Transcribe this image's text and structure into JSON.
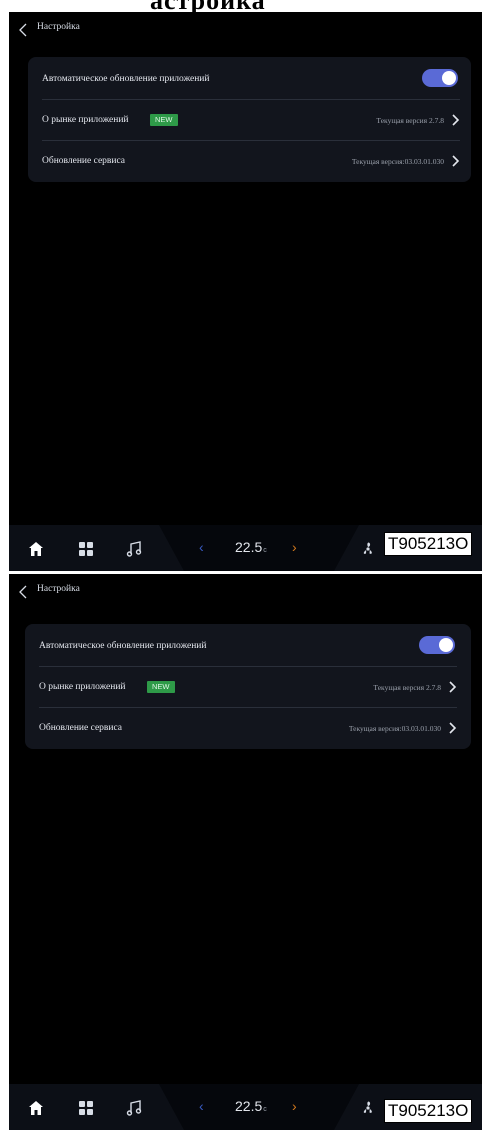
{
  "header": {
    "title": "Настройка"
  },
  "settings": {
    "auto_update_label": "Автоматическое обновление приложений",
    "auto_update_enabled": true,
    "market_label": "О рынке приложений",
    "market_badge": "NEW",
    "market_version": "Текущая версия 2.7.8",
    "service_label": "Обновление сервиса",
    "service_version": "Текущая версия:03.03.01.030"
  },
  "bottom_bar": {
    "temperature": "22.5",
    "temperature_unit": "c",
    "arrow_left": "‹",
    "arrow_right": "›"
  },
  "watermark": "T905213O",
  "top_heading_fragment": "астройка",
  "colors": {
    "screen_bg": "#000000",
    "card_bg": "#12151d",
    "toggle_on": "#5a6ad6",
    "badge_green": "#2e9a48",
    "arrow_left": "#3a5cc6",
    "arrow_right": "#d3791e"
  }
}
